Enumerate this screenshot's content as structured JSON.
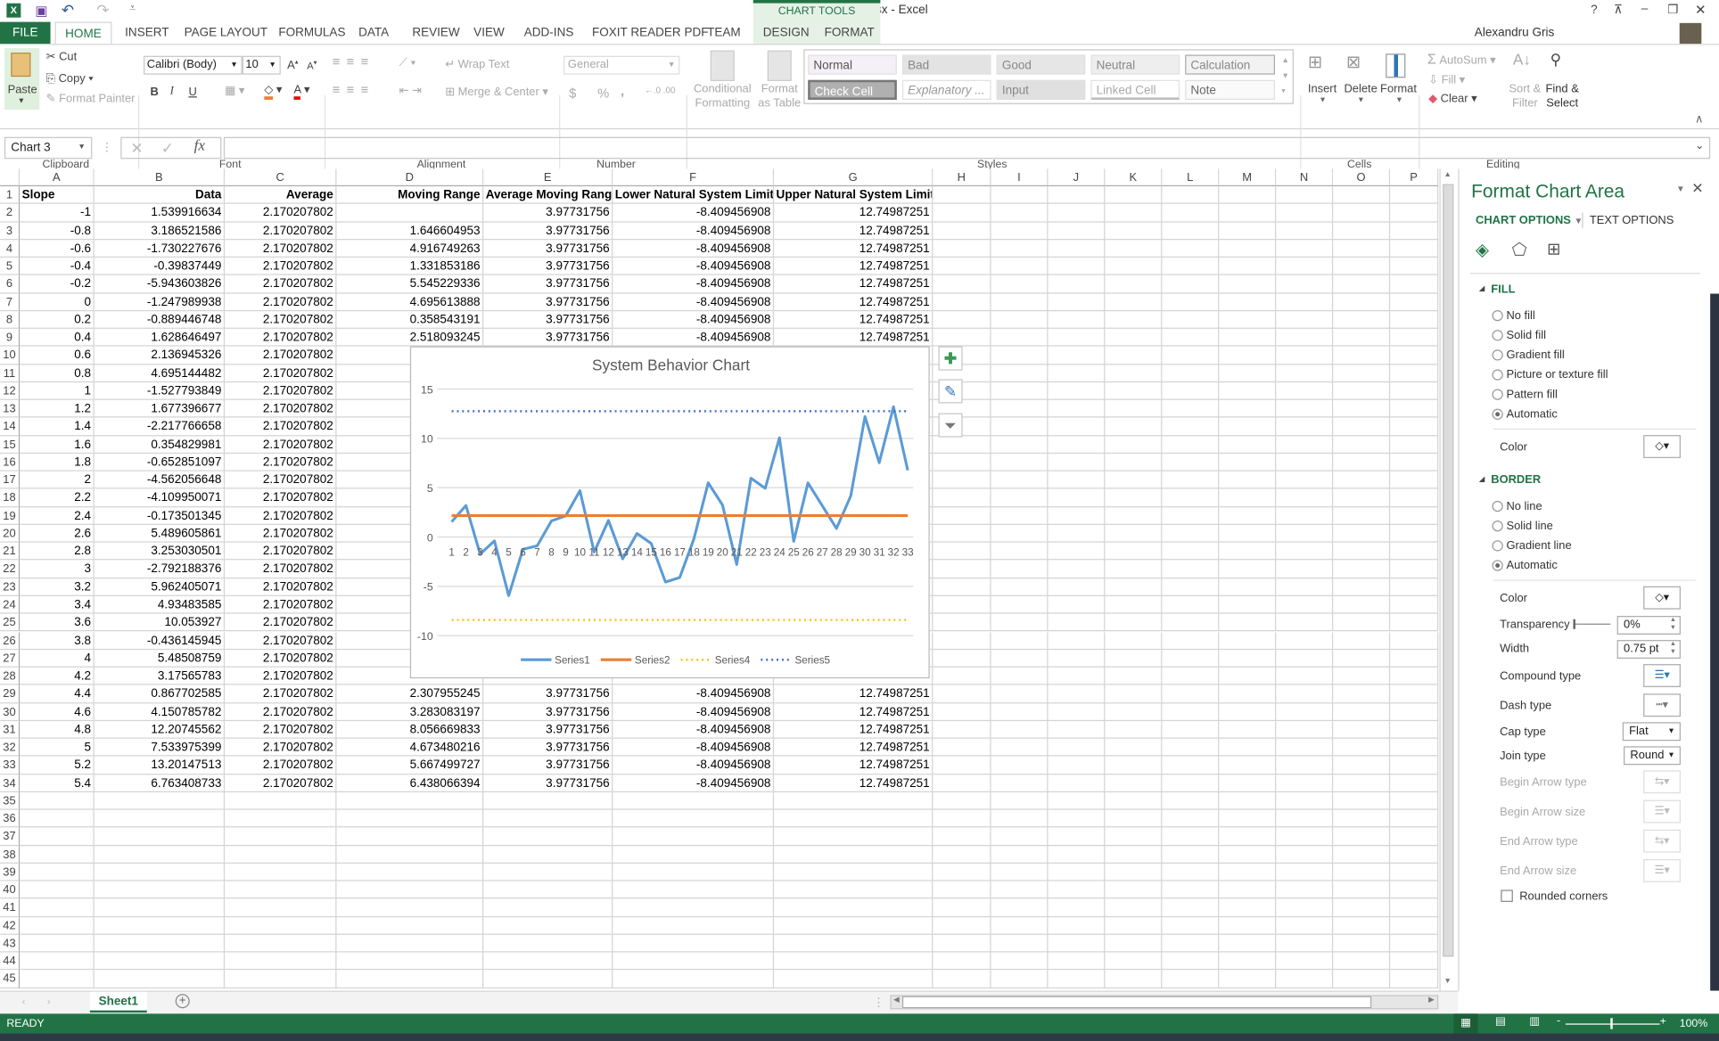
{
  "titlebar": {
    "title": "system_limits.xlsx - Excel",
    "help": "?",
    "user": "Alexandru Gris",
    "chart_tools": "CHART TOOLS"
  },
  "tabs": [
    {
      "label": "FILE"
    },
    {
      "label": "HOME"
    },
    {
      "label": "INSERT"
    },
    {
      "label": "PAGE LAYOUT"
    },
    {
      "label": "FORMULAS"
    },
    {
      "label": "DATA"
    },
    {
      "label": "REVIEW"
    },
    {
      "label": "VIEW"
    },
    {
      "label": "ADD-INS"
    },
    {
      "label": "FOXIT READER PDF"
    },
    {
      "label": "TEAM"
    },
    {
      "label": "DESIGN"
    },
    {
      "label": "FORMAT"
    }
  ],
  "active_tab": "HOME",
  "ribbon": {
    "clipboard": {
      "paste": "Paste",
      "cut": "Cut",
      "copy": "Copy",
      "format_painter": "Format Painter",
      "label": "Clipboard"
    },
    "font": {
      "name": "Calibri (Body)",
      "size": "10",
      "bold": "B",
      "italic": "I",
      "underline": "U",
      "label": "Font"
    },
    "alignment": {
      "wrap": "Wrap Text",
      "merge": "Merge & Center",
      "label": "Alignment"
    },
    "number": {
      "format": "General",
      "currency": "$",
      "percent": "%",
      "comma": ",",
      "label": "Number"
    },
    "styles": {
      "conditional": "Conditional Formatting",
      "format_table": "Format as Table",
      "cells": [
        "Normal",
        "Bad",
        "Good",
        "Neutral",
        "Calculation",
        "Check Cell",
        "Explanatory ...",
        "Input",
        "Linked Cell",
        "Note"
      ],
      "label": "Styles"
    },
    "cells": {
      "insert": "Insert",
      "delete": "Delete",
      "format": "Format",
      "label": "Cells"
    },
    "editing": {
      "autosum": "AutoSum",
      "fill": "Fill",
      "clear": "Clear",
      "sort": "Sort & Filter",
      "find": "Find & Select",
      "label": "Editing"
    }
  },
  "formula_bar": {
    "name_box": "Chart 3",
    "fx": "fx",
    "value": ""
  },
  "grid": {
    "columns": [
      "A",
      "B",
      "C",
      "D",
      "E",
      "F",
      "G",
      "H",
      "I",
      "J",
      "K",
      "L",
      "M",
      "N",
      "O",
      "P"
    ],
    "row_count": 45,
    "rows": [
      [
        "Slope",
        "Data",
        "Average",
        "Moving Range",
        "Average Moving Range",
        "Lower Natural System Limit",
        "Upper Natural System Limit"
      ],
      [
        "-1",
        "1.539916634",
        "2.170207802",
        "",
        "3.97731756",
        "-8.409456908",
        "12.74987251"
      ],
      [
        "-0.8",
        "3.186521586",
        "2.170207802",
        "1.646604953",
        "3.97731756",
        "-8.409456908",
        "12.74987251"
      ],
      [
        "-0.6",
        "-1.730227676",
        "2.170207802",
        "4.916749263",
        "3.97731756",
        "-8.409456908",
        "12.74987251"
      ],
      [
        "-0.4",
        "-0.39837449",
        "2.170207802",
        "1.331853186",
        "3.97731756",
        "-8.409456908",
        "12.74987251"
      ],
      [
        "-0.2",
        "-5.943603826",
        "2.170207802",
        "5.545229336",
        "3.97731756",
        "-8.409456908",
        "12.74987251"
      ],
      [
        "0",
        "-1.247989938",
        "2.170207802",
        "4.695613888",
        "3.97731756",
        "-8.409456908",
        "12.74987251"
      ],
      [
        "0.2",
        "-0.889446748",
        "2.170207802",
        "0.358543191",
        "3.97731756",
        "-8.409456908",
        "12.74987251"
      ],
      [
        "0.4",
        "1.628646497",
        "2.170207802",
        "2.518093245",
        "3.97731756",
        "-8.409456908",
        "12.74987251"
      ],
      [
        "0.6",
        "2.136945326",
        "2.170207802",
        "",
        "",
        "",
        ""
      ],
      [
        "0.8",
        "4.695144482",
        "2.170207802",
        "",
        "",
        "",
        ""
      ],
      [
        "1",
        "-1.527793849",
        "2.170207802",
        "",
        "",
        "",
        ""
      ],
      [
        "1.2",
        "1.677396677",
        "2.170207802",
        "",
        "",
        "",
        ""
      ],
      [
        "1.4",
        "-2.217766658",
        "2.170207802",
        "",
        "",
        "",
        ""
      ],
      [
        "1.6",
        "0.354829981",
        "2.170207802",
        "",
        "",
        "",
        ""
      ],
      [
        "1.8",
        "-0.652851097",
        "2.170207802",
        "",
        "",
        "",
        ""
      ],
      [
        "2",
        "-4.562056648",
        "2.170207802",
        "",
        "",
        "",
        ""
      ],
      [
        "2.2",
        "-4.109950071",
        "2.170207802",
        "",
        "",
        "",
        ""
      ],
      [
        "2.4",
        "-0.173501345",
        "2.170207802",
        "",
        "",
        "",
        ""
      ],
      [
        "2.6",
        "5.489605861",
        "2.170207802",
        "",
        "",
        "",
        ""
      ],
      [
        "2.8",
        "3.253030501",
        "2.170207802",
        "",
        "",
        "",
        ""
      ],
      [
        "3",
        "-2.792188376",
        "2.170207802",
        "",
        "",
        "",
        ""
      ],
      [
        "3.2",
        "5.962405071",
        "2.170207802",
        "",
        "",
        "",
        ""
      ],
      [
        "3.4",
        "4.93483585",
        "2.170207802",
        "",
        "",
        "",
        ""
      ],
      [
        "3.6",
        "10.053927",
        "2.170207802",
        "",
        "",
        "",
        ""
      ],
      [
        "3.8",
        "-0.436145945",
        "2.170207802",
        "",
        "",
        "",
        ""
      ],
      [
        "4",
        "5.48508759",
        "2.170207802",
        "",
        "",
        "",
        ""
      ],
      [
        "4.2",
        "3.17565783",
        "2.170207802",
        "",
        "",
        "",
        ""
      ],
      [
        "4.4",
        "0.867702585",
        "2.170207802",
        "2.307955245",
        "3.97731756",
        "-8.409456908",
        "12.74987251"
      ],
      [
        "4.6",
        "4.150785782",
        "2.170207802",
        "3.283083197",
        "3.97731756",
        "-8.409456908",
        "12.74987251"
      ],
      [
        "4.8",
        "12.20745562",
        "2.170207802",
        "8.056669833",
        "3.97731756",
        "-8.409456908",
        "12.74987251"
      ],
      [
        "5",
        "7.533975399",
        "2.170207802",
        "4.673480216",
        "3.97731756",
        "-8.409456908",
        "12.74987251"
      ],
      [
        "5.2",
        "13.20147513",
        "2.170207802",
        "5.667499727",
        "3.97731756",
        "-8.409456908",
        "12.74987251"
      ],
      [
        "5.4",
        "6.763408733",
        "2.170207802",
        "6.438066394",
        "3.97731756",
        "-8.409456908",
        "12.74987251"
      ]
    ]
  },
  "chart_data": {
    "type": "line",
    "title": "System Behavior Chart",
    "categories": [
      "1",
      "2",
      "3",
      "4",
      "5",
      "6",
      "7",
      "8",
      "9",
      "10",
      "11",
      "12",
      "13",
      "14",
      "15",
      "16",
      "17",
      "18",
      "19",
      "20",
      "21",
      "22",
      "23",
      "24",
      "25",
      "26",
      "27",
      "28",
      "29",
      "30",
      "31",
      "32",
      "33"
    ],
    "ylim": [
      -10,
      15
    ],
    "yticks": [
      "15",
      "10",
      "5",
      "0",
      "-5",
      "-10"
    ],
    "grid": true,
    "legend_position": "bottom",
    "series": [
      {
        "name": "Series1",
        "color": "#5b9bd5",
        "style": "solid",
        "values": [
          1.539916634,
          3.186521586,
          -1.730227676,
          -0.39837449,
          -5.943603826,
          -1.247989938,
          -0.889446748,
          1.628646497,
          2.136945326,
          4.695144482,
          -1.527793849,
          1.677396677,
          -2.217766658,
          0.354829981,
          -0.652851097,
          -4.562056648,
          -4.109950071,
          -0.173501345,
          5.489605861,
          3.253030501,
          -2.792188376,
          5.962405071,
          4.93483585,
          10.053927,
          -0.436145945,
          5.48508759,
          3.17565783,
          0.867702585,
          4.150785782,
          12.20745562,
          7.533975399,
          13.20147513,
          6.763408733
        ]
      },
      {
        "name": "Series2",
        "color": "#ed7d31",
        "style": "solid",
        "values": [
          2.170207802
        ]
      },
      {
        "name": "Series4",
        "color": "#ffc000",
        "style": "dotted",
        "values": [
          -8.409456908
        ]
      },
      {
        "name": "Series5",
        "color": "#4472c4",
        "style": "dotted",
        "values": [
          12.74987251
        ]
      }
    ]
  },
  "sheet_tabs": [
    {
      "label": "Sheet1"
    }
  ],
  "status": {
    "ready": "READY",
    "zoom": "100%"
  },
  "pane": {
    "title": "Format Chart Area",
    "chart_options": "CHART OPTIONS",
    "text_options": "TEXT OPTIONS",
    "fill": {
      "header": "FILL",
      "options": [
        "No fill",
        "Solid fill",
        "Gradient fill",
        "Picture or texture fill",
        "Pattern fill",
        "Automatic"
      ],
      "selected": "Automatic",
      "color_label": "Color"
    },
    "border": {
      "header": "BORDER",
      "options": [
        "No line",
        "Solid line",
        "Gradient line",
        "Automatic"
      ],
      "selected": "Automatic",
      "color_label": "Color",
      "transparency_label": "Transparency",
      "transparency": "0%",
      "width_label": "Width",
      "width": "0.75 pt",
      "compound_label": "Compound type",
      "dash_label": "Dash type",
      "cap_label": "Cap type",
      "cap": "Flat",
      "join_label": "Join type",
      "join": "Round",
      "begin_arrow_type": "Begin Arrow type",
      "begin_arrow_size": "Begin Arrow size",
      "end_arrow_type": "End Arrow type",
      "end_arrow_size": "End Arrow size",
      "rounded_corners": "Rounded corners",
      "rounded_checked": false
    }
  }
}
